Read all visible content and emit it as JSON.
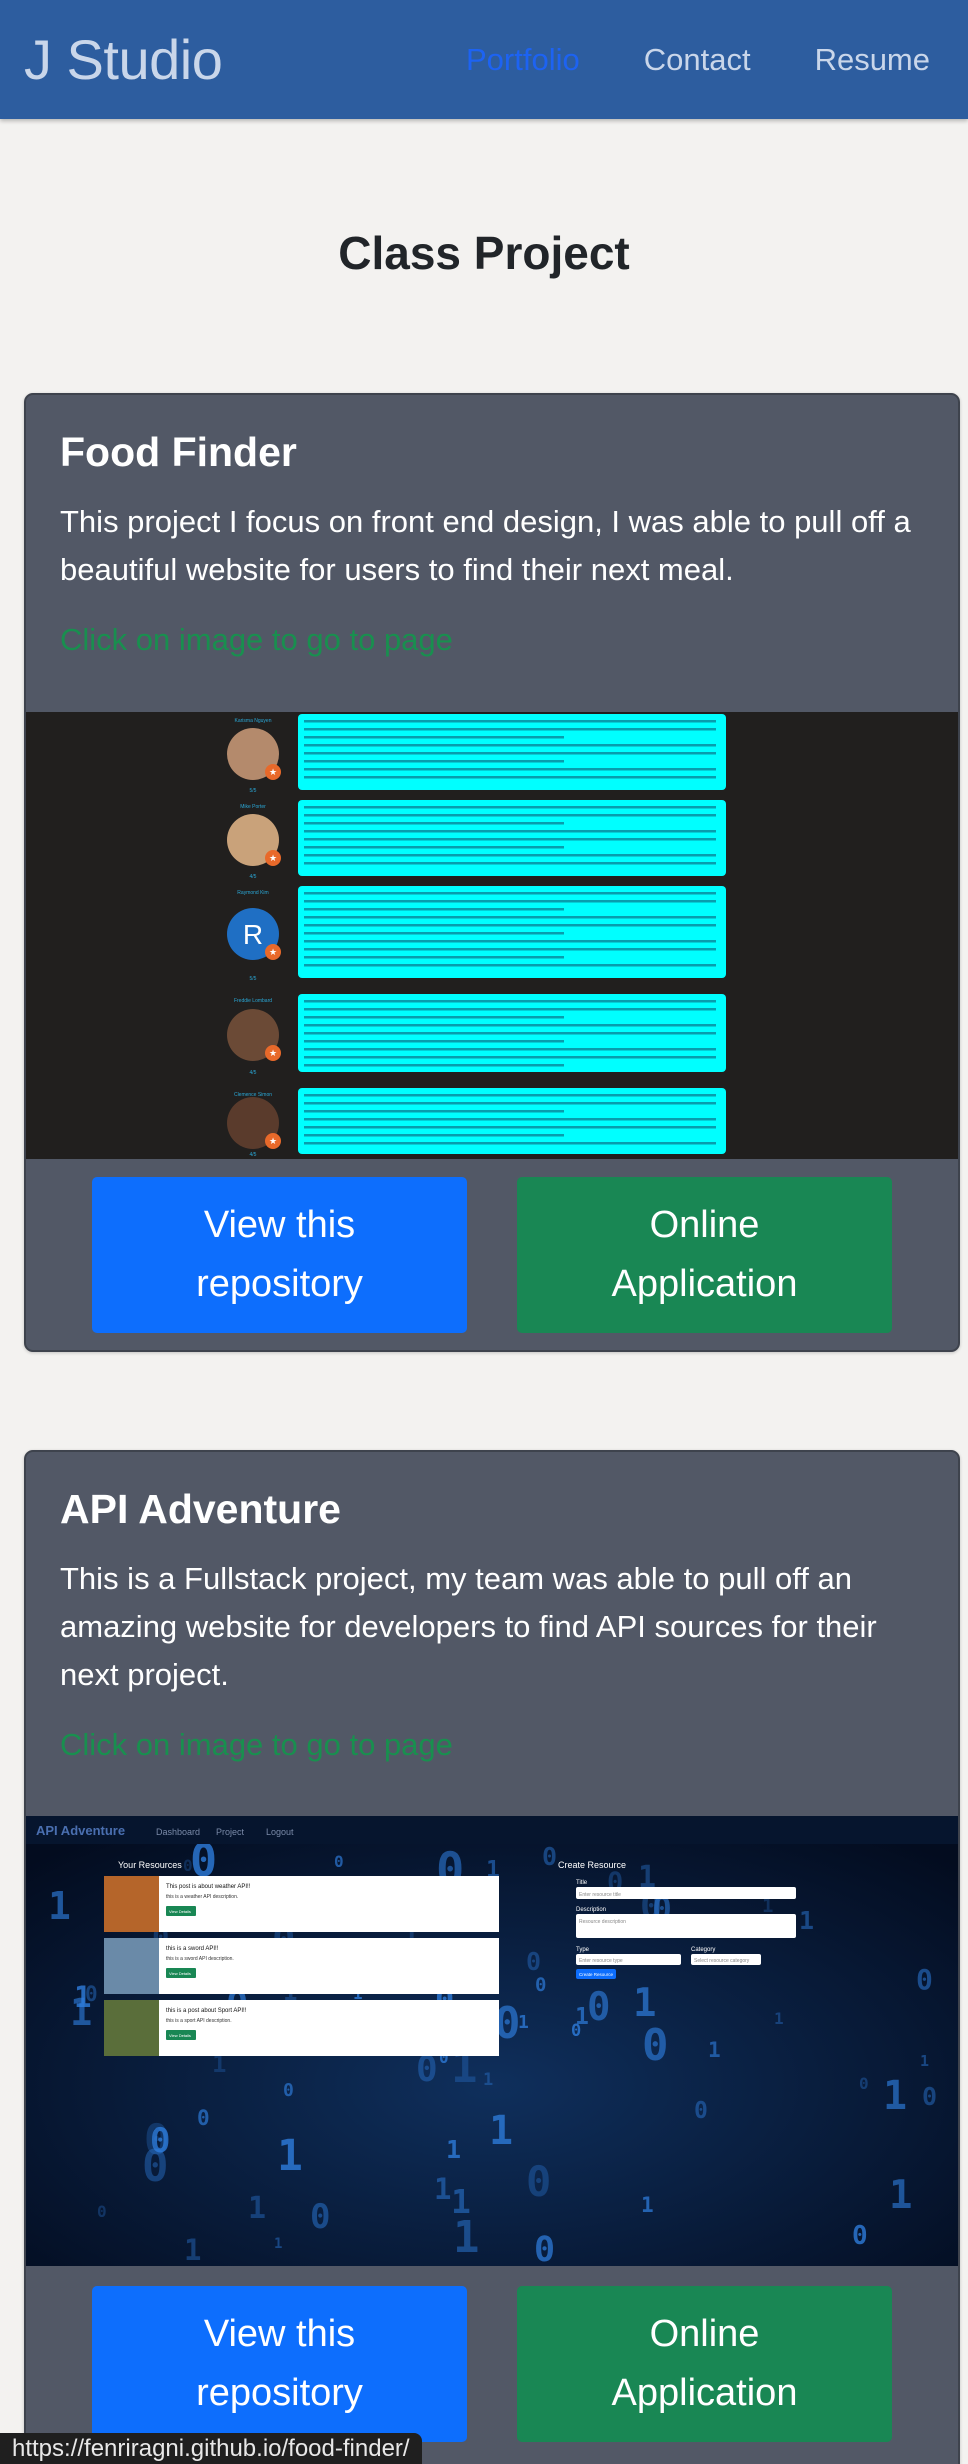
{
  "nav": {
    "brand": "J Studio",
    "links": [
      "Portfolio",
      "Contact",
      "Resume"
    ]
  },
  "section_title": "Class Project",
  "projects": [
    {
      "title": "Food Finder",
      "description": "This project I focus on front end design, I was able to pull off a beautiful website for users to find their next meal.",
      "hint": "Click on image to go to page",
      "repo_button": "View this repository",
      "app_button": "Online Application",
      "screenshot": {
        "reviewers": [
          "Karisma Nguyen",
          "Mike Porter",
          "Raymond Kim",
          "Freddie Lombard",
          "Clemence Simon"
        ],
        "ratings": [
          "5/5",
          "4/5",
          "5/5",
          "4/5",
          "4/5"
        ]
      }
    },
    {
      "title": "API Adventure",
      "description": "This is a Fullstack project, my team was able to pull off an amazing website for developers to find API sources for their next project.",
      "hint": "Click on image to go to page",
      "repo_button": "View this repository",
      "app_button": "Online Application",
      "screenshot": {
        "app_name": "API Adventure",
        "nav_items": [
          "Dashboard",
          "Project",
          "Logout"
        ],
        "resources_heading": "Your Resources",
        "resources": [
          {
            "title": "This post is about weather API!!",
            "desc": "this is a weather API description.",
            "button": "View Details"
          },
          {
            "title": "this is a sword API!!",
            "desc": "this is a sword API description.",
            "button": "View Details"
          },
          {
            "title": "this is a post about Sport API!!",
            "desc": "this is a sport API description.",
            "button": "View Details"
          }
        ],
        "form_heading": "Create Resource",
        "form_labels": [
          "Title",
          "Description",
          "Type",
          "Category"
        ],
        "form_placeholders": [
          "Enter resource title",
          "Resource description",
          "Enter resource type",
          "Select resource category"
        ],
        "form_button": "Create Resource"
      }
    }
  ],
  "status_url": "https://fenriragni.github.io/food-finder/",
  "colors": {
    "navbar": "#2d5d9f",
    "nav_active": "#1d63f2",
    "card_bg": "#525866",
    "hint": "#198f4f",
    "btn_primary": "#0d6efd",
    "btn_success": "#198754",
    "review_cyan": "#00ffff"
  }
}
